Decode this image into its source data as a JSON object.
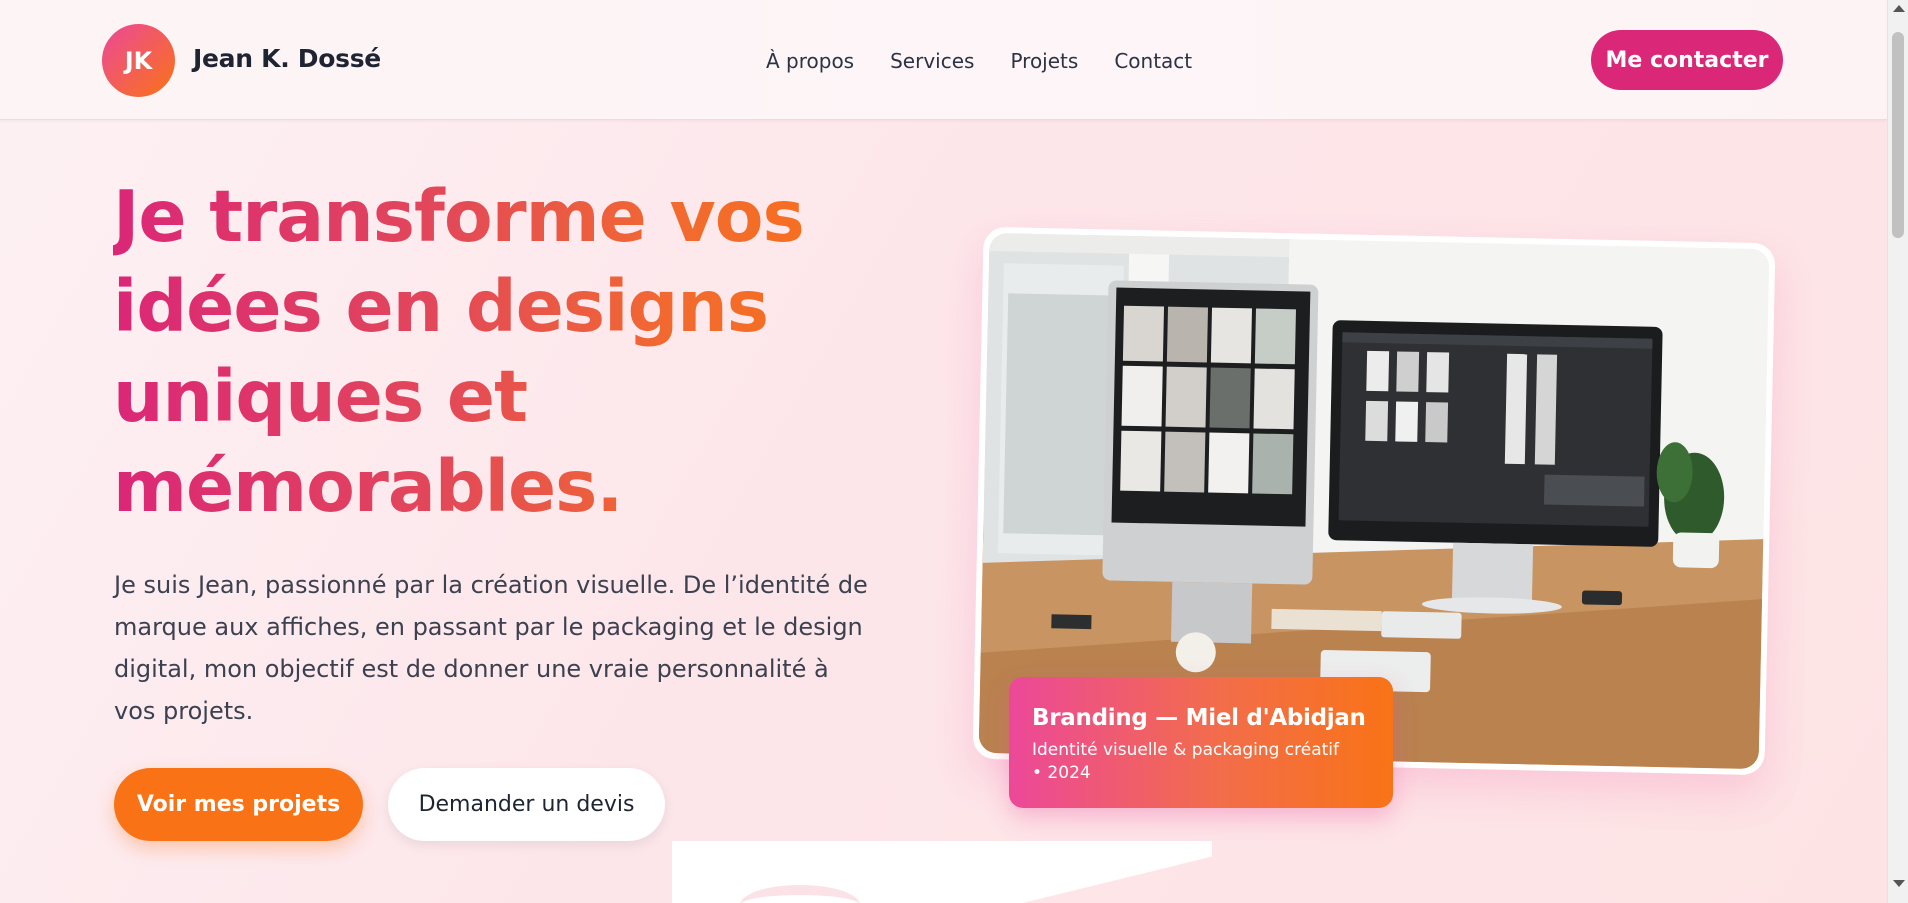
{
  "header": {
    "logo_initials": "JK",
    "brand_name": "Jean K. Dossé",
    "nav": [
      "À propos",
      "Services",
      "Projets",
      "Contact"
    ],
    "cta_label": "Me contacter"
  },
  "hero": {
    "title": "Je transforme vos idées en designs uniques et mémorables.",
    "description": "Je suis Jean, passionné par la création visuelle. De l’identité de marque aux affiches, en passant par le packaging et le design digital, mon objectif est de donner une vraie personnalité à vos projets.",
    "primary_button": "Voir mes projets",
    "secondary_button": "Demander un devis"
  },
  "featured": {
    "image_subject": "dual-monitor-design-workspace",
    "caption_title": "Branding — Miel d'Abidjan",
    "caption_subtitle": "Identité visuelle & packaging créatif • 2024"
  },
  "colors": {
    "accent_pink": "#db2777",
    "accent_orange": "#f97316"
  }
}
